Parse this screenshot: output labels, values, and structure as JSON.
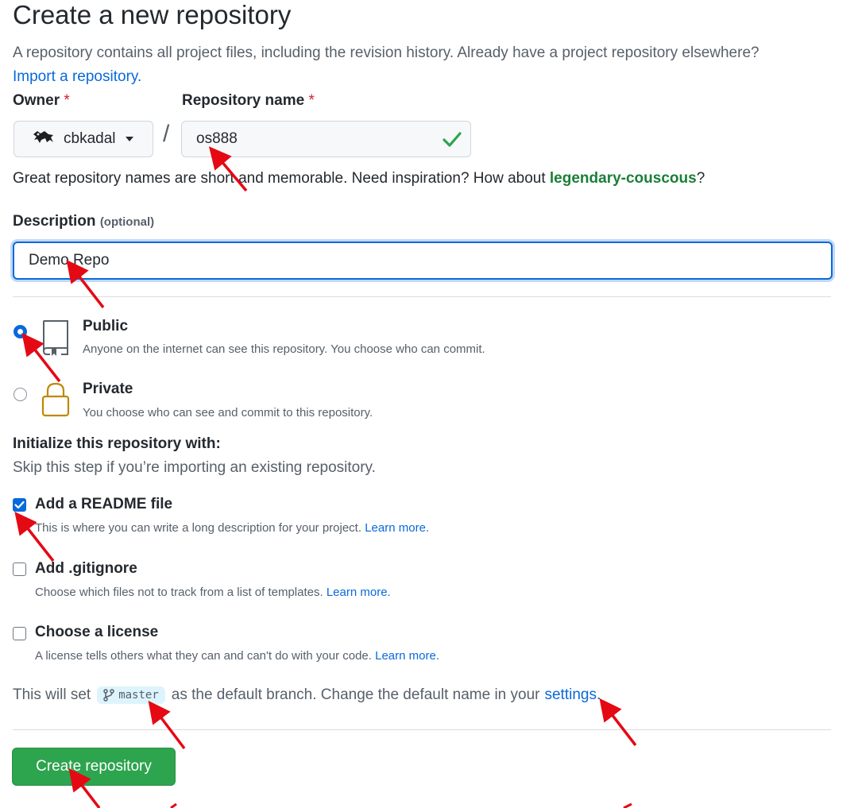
{
  "page": {
    "title": "Create a new repository",
    "intro_text": "A repository contains all project files, including the revision history. Already have a project repository elsewhere?",
    "import_link": "Import a repository."
  },
  "owner": {
    "label": "Owner",
    "required_mark": "*",
    "value": "cbkadal"
  },
  "repo_name": {
    "label": "Repository name",
    "required_mark": "*",
    "value": "os888"
  },
  "name_hint": {
    "prefix": "Great repository names are short and memorable. Need inspiration? How about ",
    "suggestion": "legendary-couscous",
    "suffix": "?"
  },
  "description": {
    "label": "Description",
    "optional": "(optional)",
    "value": "Demo Repo"
  },
  "visibility": {
    "public": {
      "title": "Public",
      "text": "Anyone on the internet can see this repository. You choose who can commit.",
      "selected": true
    },
    "private": {
      "title": "Private",
      "text": "You choose who can see and commit to this repository.",
      "selected": false
    }
  },
  "initialize": {
    "heading": "Initialize this repository with:",
    "subtext": "Skip this step if you’re importing an existing repository.",
    "learn_more": "Learn more.",
    "readme": {
      "title": "Add a README file",
      "text": "This is where you can write a long description for your project.",
      "checked": true
    },
    "gitignore": {
      "title": "Add .gitignore",
      "text": "Choose which files not to track from a list of templates.",
      "checked": false
    },
    "license": {
      "title": "Choose a license",
      "text": "A license tells others what they can and can't do with your code.",
      "checked": false
    }
  },
  "branch": {
    "prefix": "This will set",
    "name": "master",
    "middle": "as the default branch. Change the default name in your",
    "settings_link": "settings",
    "suffix": "."
  },
  "submit": {
    "label": "Create repository"
  },
  "colors": {
    "primary_button": "#2da44e",
    "link": "#0969da",
    "annotation_arrow": "#e50914"
  }
}
